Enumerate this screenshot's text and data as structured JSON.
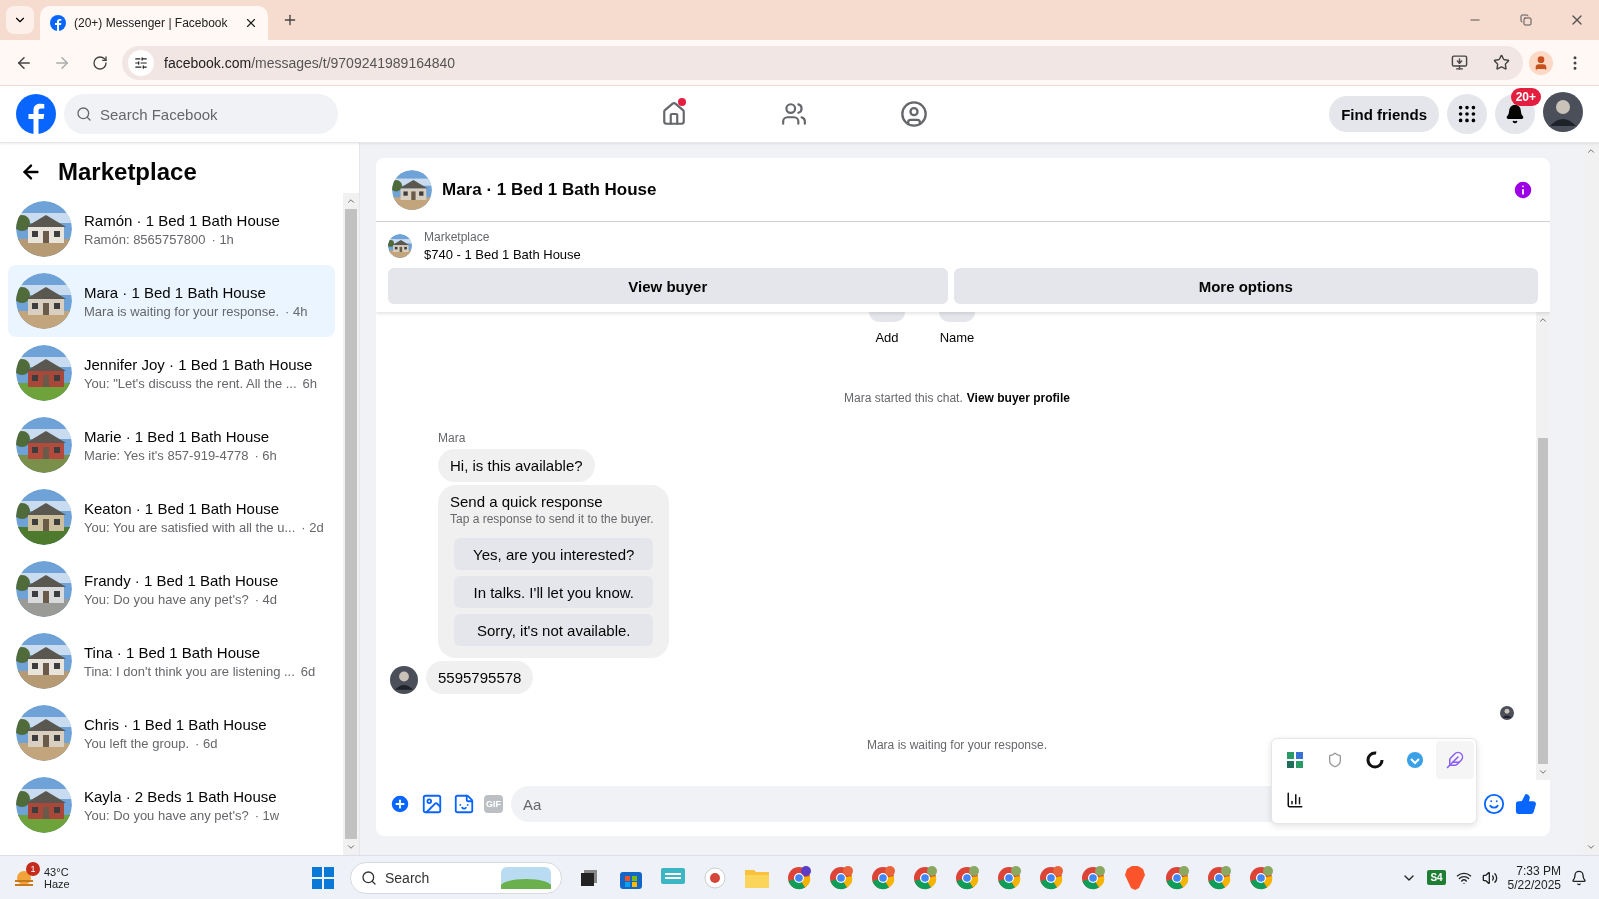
{
  "browser": {
    "tabs": [
      {
        "title": "(20+) Messenger | Facebook",
        "selected": true
      }
    ],
    "url_host": "facebook.com",
    "url_path": "/messages/t/9709241989164840"
  },
  "header": {
    "search": {
      "placeholder": "Search Facebook"
    },
    "nav": [
      {
        "kind": "home",
        "selected": false,
        "dot": true
      },
      {
        "kind": "friends",
        "selected": false,
        "dot": false
      },
      {
        "kind": "groups",
        "selected": false,
        "dot": false
      }
    ],
    "find_friends": "Find friends",
    "notification_badge": "20+"
  },
  "sidebar": {
    "title": "Marketplace",
    "conversations": [
      {
        "name": "Ramón · 1 Bed 1 Bath House",
        "preview": "Ramón: 8565757800",
        "time": "· 1h",
        "selected": false
      },
      {
        "name": "Mara · 1 Bed 1 Bath House",
        "preview": "Mara is waiting for your response.",
        "time": "· 4h",
        "selected": true
      },
      {
        "name": "Jennifer Joy · 1 Bed 1 Bath House",
        "preview": "You: \"Let's discuss the rent. All the ...",
        "time": "6h",
        "selected": false
      },
      {
        "name": "Marie · 1 Bed 1 Bath House",
        "preview": "Marie: Yes it's 857-919-4778",
        "time": "· 6h",
        "selected": false
      },
      {
        "name": "Keaton · 1 Bed 1 Bath House",
        "preview": "You: You are satisfied with all the u...",
        "time": "· 2d",
        "selected": false
      },
      {
        "name": "Frandy · 1 Bed 1 Bath House",
        "preview": "You: Do you have any pet's?",
        "time": "· 4d",
        "selected": false
      },
      {
        "name": "Tina · 1 Bed 1 Bath House",
        "preview": "Tina: I don't think you are listening ...",
        "time": "6d",
        "selected": false
      },
      {
        "name": "Chris · 1 Bed 1 Bath House",
        "preview": "You left the group.",
        "time": "· 6d",
        "selected": false
      },
      {
        "name": "Kayla · 2 Beds 1 Bath House",
        "preview": "You: Do you have any pet's?",
        "time": "· 1w",
        "selected": false
      }
    ]
  },
  "chat": {
    "title": "Mara · 1 Bed 1 Bath House",
    "listing": {
      "label": "Marketplace",
      "summary": "$740 - 1 Bed 1 Bath House"
    },
    "buttons": [
      "View buyer",
      "More options"
    ],
    "actions": [
      "Add",
      "Name"
    ],
    "started_note": "Mara started this chat.",
    "started_link": "View buyer profile",
    "sender": "Mara",
    "first_message": "Hi, is this available?",
    "quick_response": {
      "title": "Send a quick response",
      "subtitle": "Tap a response to send it to the buyer.",
      "options": [
        "Yes, are you interested?",
        "In talks. I'll let you know.",
        "Sorry, it's not available."
      ]
    },
    "second_message": "5595795578",
    "waiting_note": "Mara is waiting for your response.",
    "composer": {
      "placeholder": "Aa"
    },
    "gif_label": "GIF"
  },
  "taskbar": {
    "weather": {
      "temp": "43°C",
      "condition": "Haze",
      "badge": "1"
    },
    "search": {
      "placeholder": "Search"
    },
    "tray_label": "S4",
    "time": "7:33 PM",
    "date": "5/22/2025"
  }
}
